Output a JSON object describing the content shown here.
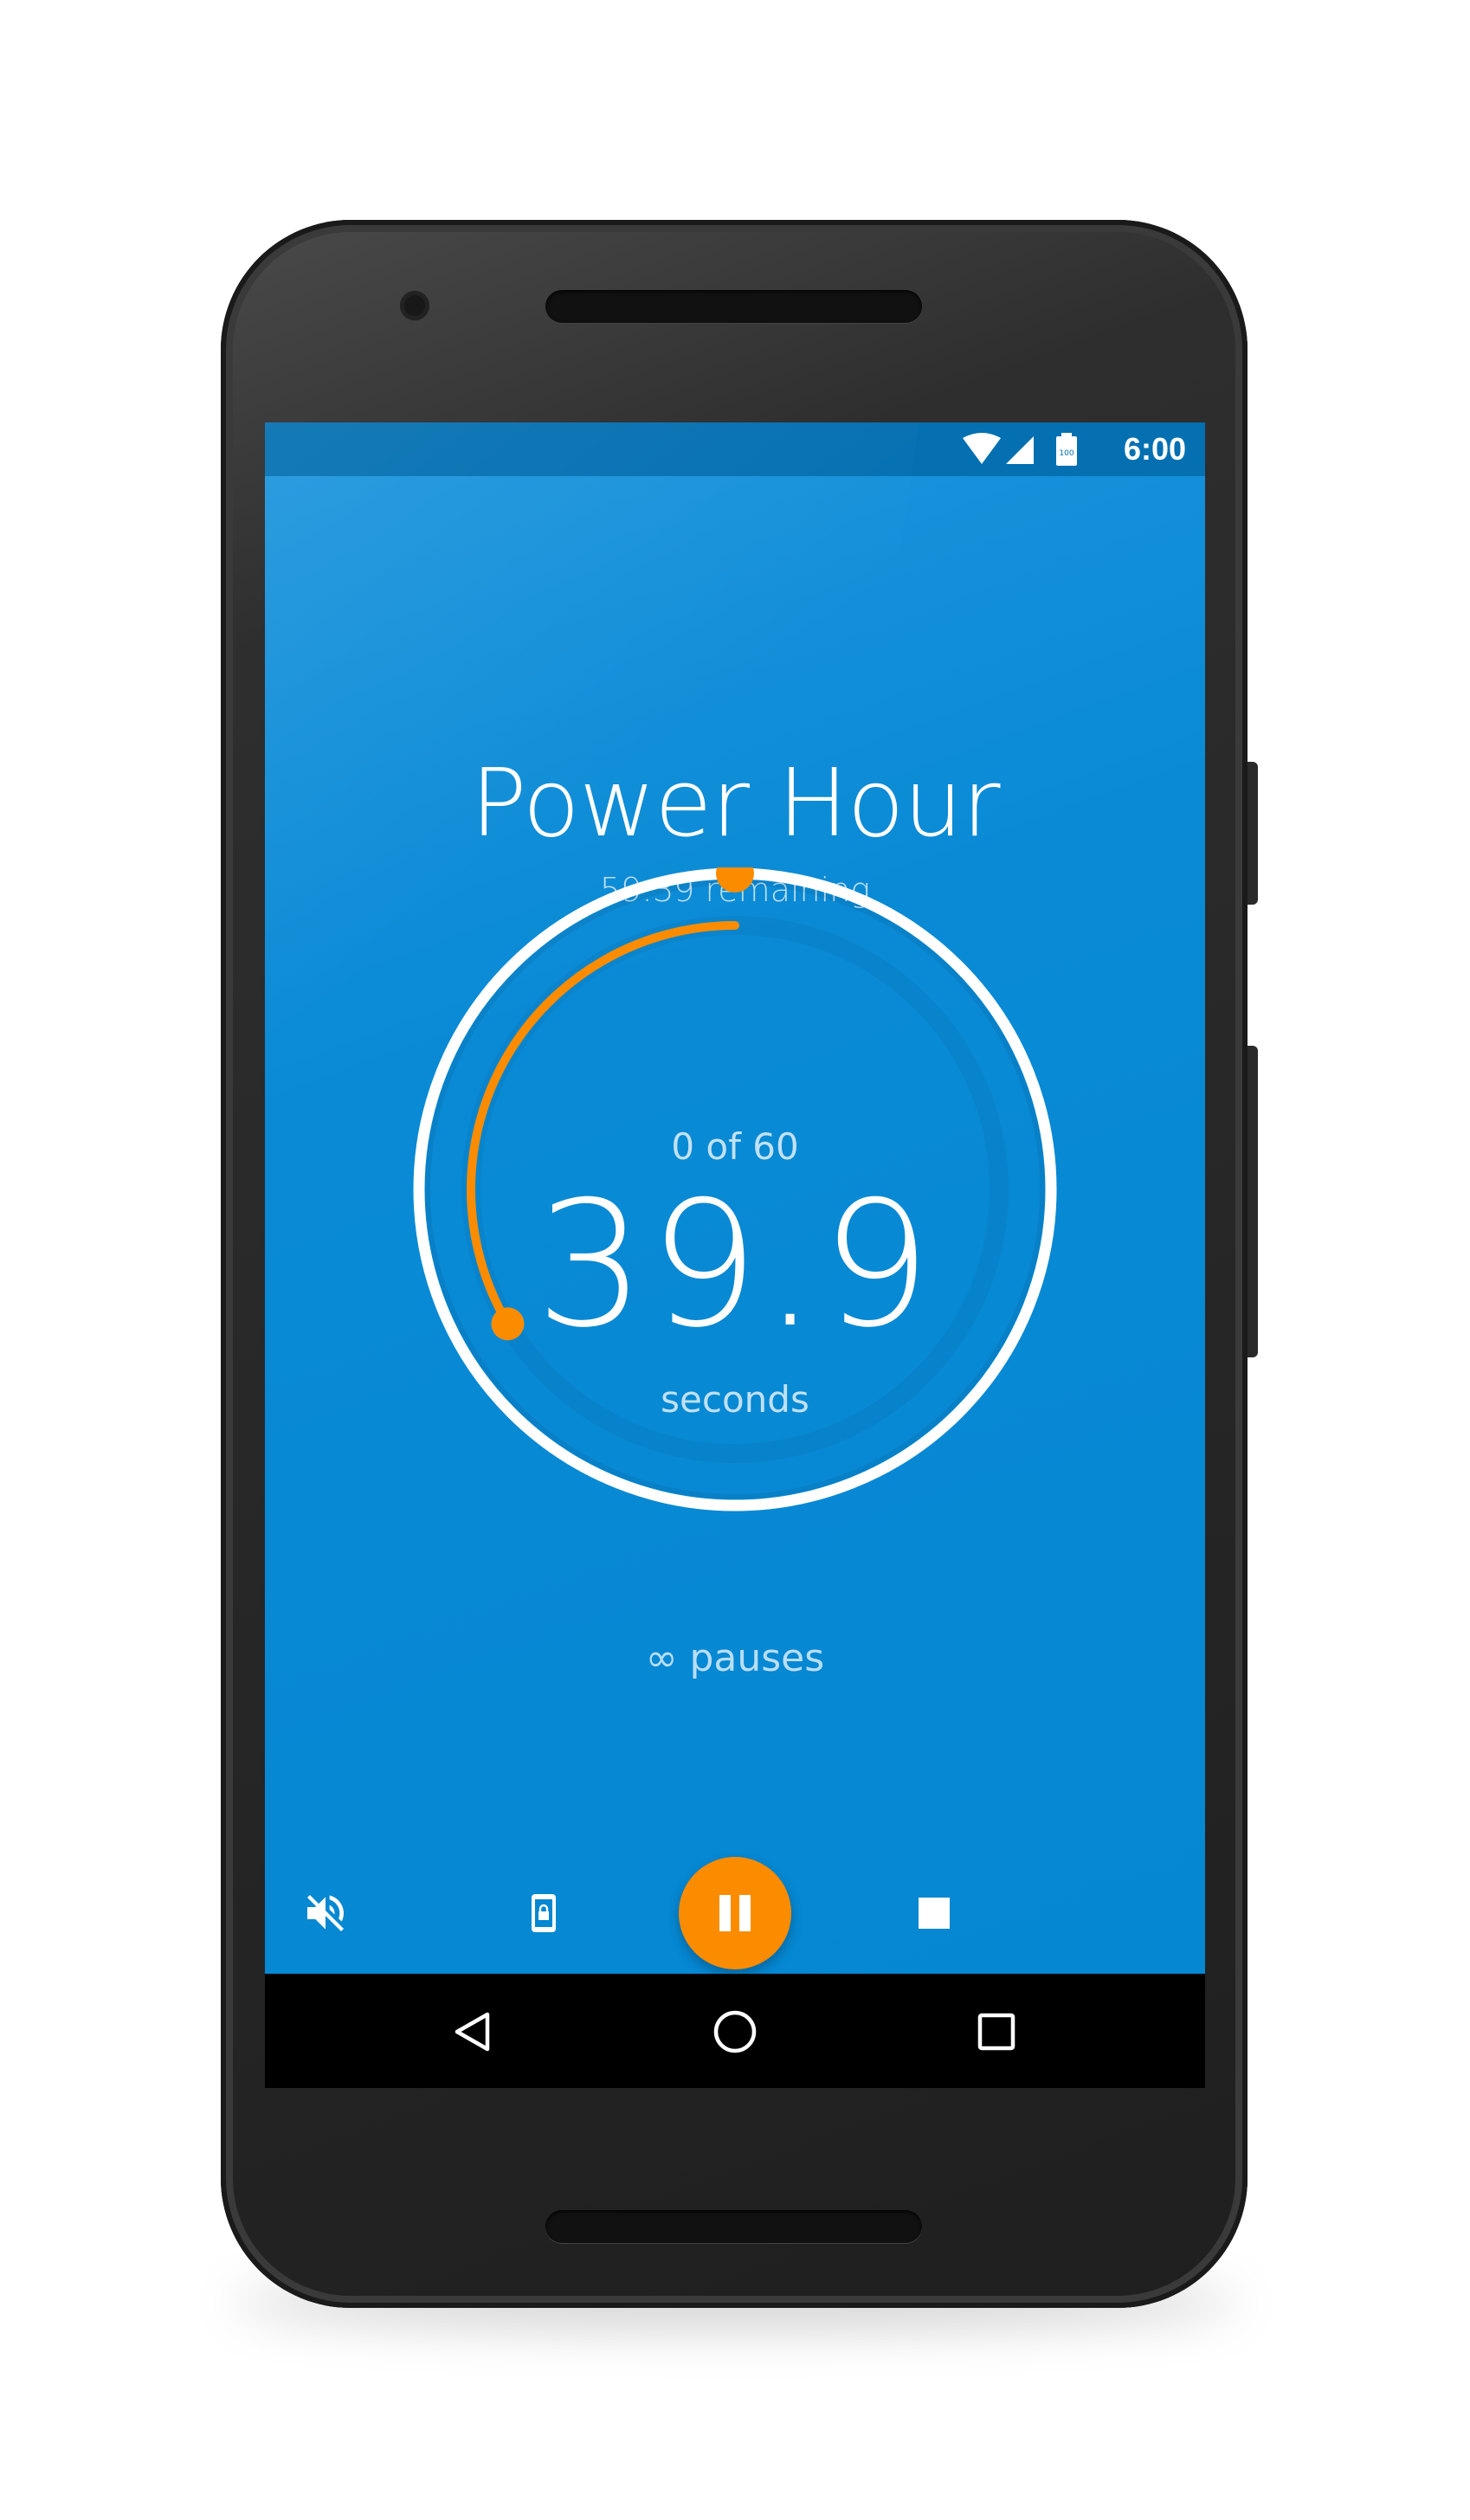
{
  "status_bar": {
    "time": "6:00",
    "battery_level": "100",
    "icons": [
      "wifi-icon",
      "cellular-signal-icon",
      "battery-icon"
    ]
  },
  "app": {
    "title": "Power Hour",
    "remaining": "59:39 remaining",
    "count": "0 of 60",
    "seconds_value": "39.9",
    "seconds_label": "seconds",
    "pauses": "∞ pauses"
  },
  "dial": {
    "progress_fraction": 0.335,
    "ring_color": "#ffffff",
    "progress_color": "#fb8c00"
  },
  "toolbar": {
    "buttons": [
      "mute-icon",
      "screen-lock-icon",
      "pause-icon",
      "stop-icon"
    ]
  },
  "nav_bar": {
    "buttons": [
      "back-icon",
      "home-icon",
      "recents-icon"
    ]
  },
  "colors": {
    "background": "#0589d3",
    "status_bar": "#0470b2",
    "accent": "#fb8c00",
    "nav_bar": "#000000"
  }
}
